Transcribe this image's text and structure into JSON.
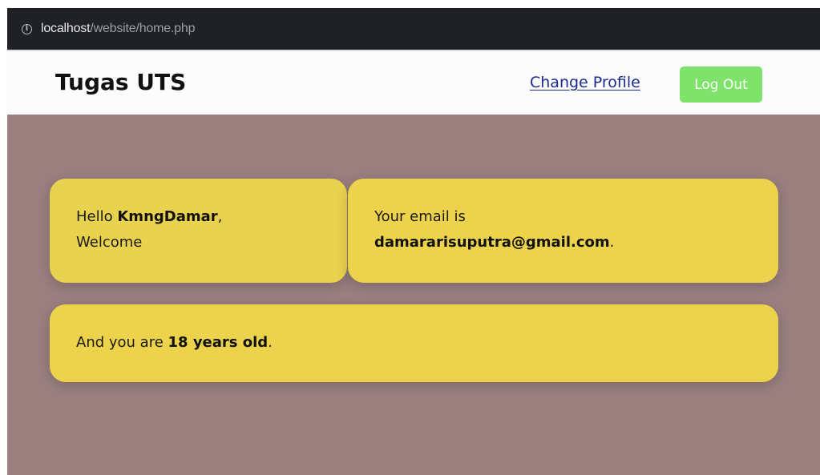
{
  "browser": {
    "url_host": "localhost",
    "url_path": "/website/home.php",
    "info_icon": "info-icon"
  },
  "navbar": {
    "brand": "Tugas UTS",
    "change_profile_label": "Change Profile",
    "logout_label": "Log Out"
  },
  "cards": {
    "hello_prefix": "Hello ",
    "username": "KmngDamar",
    "hello_suffix": ",",
    "welcome": "Welcome",
    "email_prefix": "Your email is",
    "email": "damararisuputra@gmail.com",
    "email_suffix": ".",
    "age_prefix": "And you are ",
    "age": "18 years old",
    "age_suffix": "."
  },
  "colors": {
    "content_background": "#9a7f7f",
    "card_background": "#edd34b",
    "logout_button": "#7fe36b",
    "link": "#1c2a8c",
    "urlbar": "#202124"
  }
}
